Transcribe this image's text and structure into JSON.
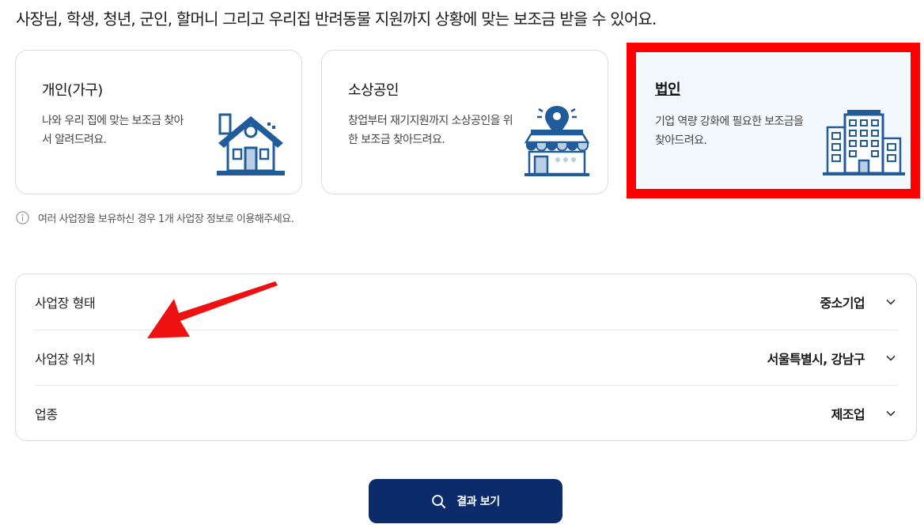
{
  "headline": "사장님, 학생, 청년, 군인, 할머니 그리고 우리집 반려동물 지원까지 상황에 맞는 보조금 받을 수 있어요.",
  "categories": [
    {
      "title": "개인(가구)",
      "description": "나와 우리 집에 맞는 보조금 찾아서 알려드려요.",
      "icon": "house-icon",
      "selected": false
    },
    {
      "title": "소상공인",
      "description": "창업부터 재기지원까지 소상공인을 위한 보조금 찾아드려요.",
      "icon": "storefront-icon",
      "selected": false
    },
    {
      "title": "법인",
      "description": "기업 역량 강화에 필요한 보조금을 찾아드려요.",
      "icon": "office-building-icon",
      "selected": true
    }
  ],
  "notice": {
    "icon": "info-icon",
    "text": "여러 사업장을 보유하신 경우 1개 사업장 정보로 이용해주세요."
  },
  "filters": [
    {
      "label": "사업장 형태",
      "value": "중소기업"
    },
    {
      "label": "사업장 위치",
      "value": "서울특별시, 강남구"
    },
    {
      "label": "업종",
      "value": "제조업"
    }
  ],
  "result_button": {
    "label": "결과 보기",
    "icon": "search-icon"
  },
  "colors": {
    "primary": "#0b2b6b",
    "icon_blue": "#1f5c99",
    "icon_light": "#b9cde3",
    "highlight": "#ff0000",
    "selected_bg": "#f3f8fc",
    "border": "#d9dde3"
  }
}
